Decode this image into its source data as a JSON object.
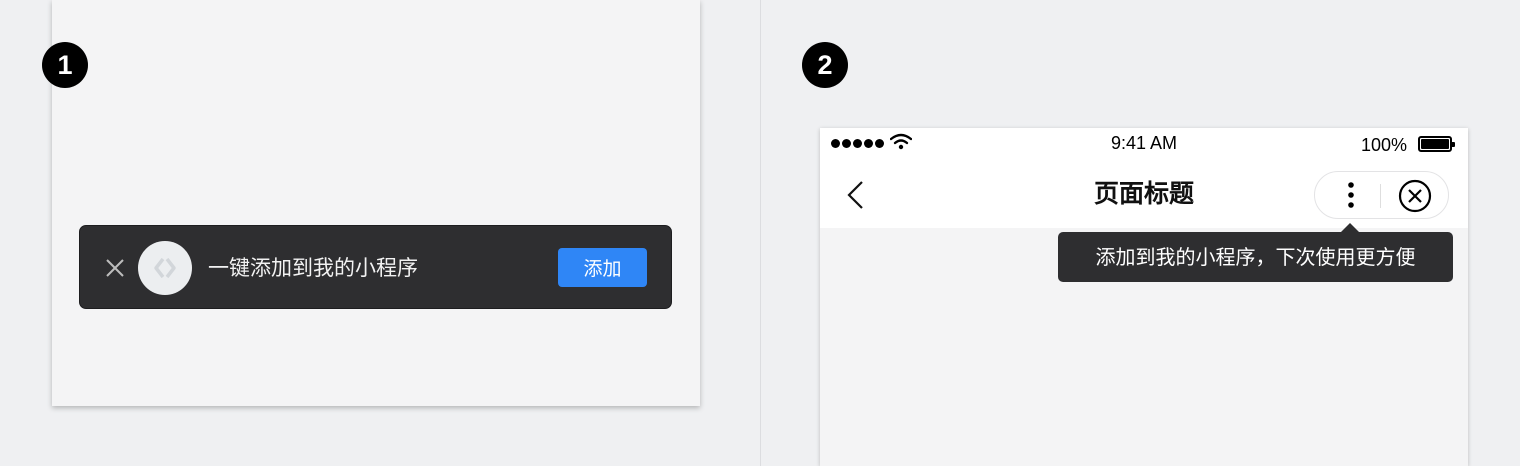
{
  "steps": {
    "step1": "1",
    "step2": "2"
  },
  "panel1": {
    "banner": {
      "close_icon": "close-icon",
      "logo_icon": "miniprogram-logo-icon",
      "text": "一键添加到我的小程序",
      "add_label": "添加"
    }
  },
  "panel2": {
    "status_bar": {
      "time": "9:41 AM",
      "battery_pct": "100%"
    },
    "nav": {
      "title": "页面标题",
      "back_icon": "chevron-left-icon",
      "more_icon": "more-vertical-icon",
      "close_icon": "close-circle-icon"
    },
    "tooltip": {
      "text": "添加到我的小程序，下次使用更方便"
    }
  },
  "colors": {
    "background": "#eff0f2",
    "panel": "#f4f4f5",
    "banner": "#2e2e30",
    "accent": "#2f86f6"
  }
}
